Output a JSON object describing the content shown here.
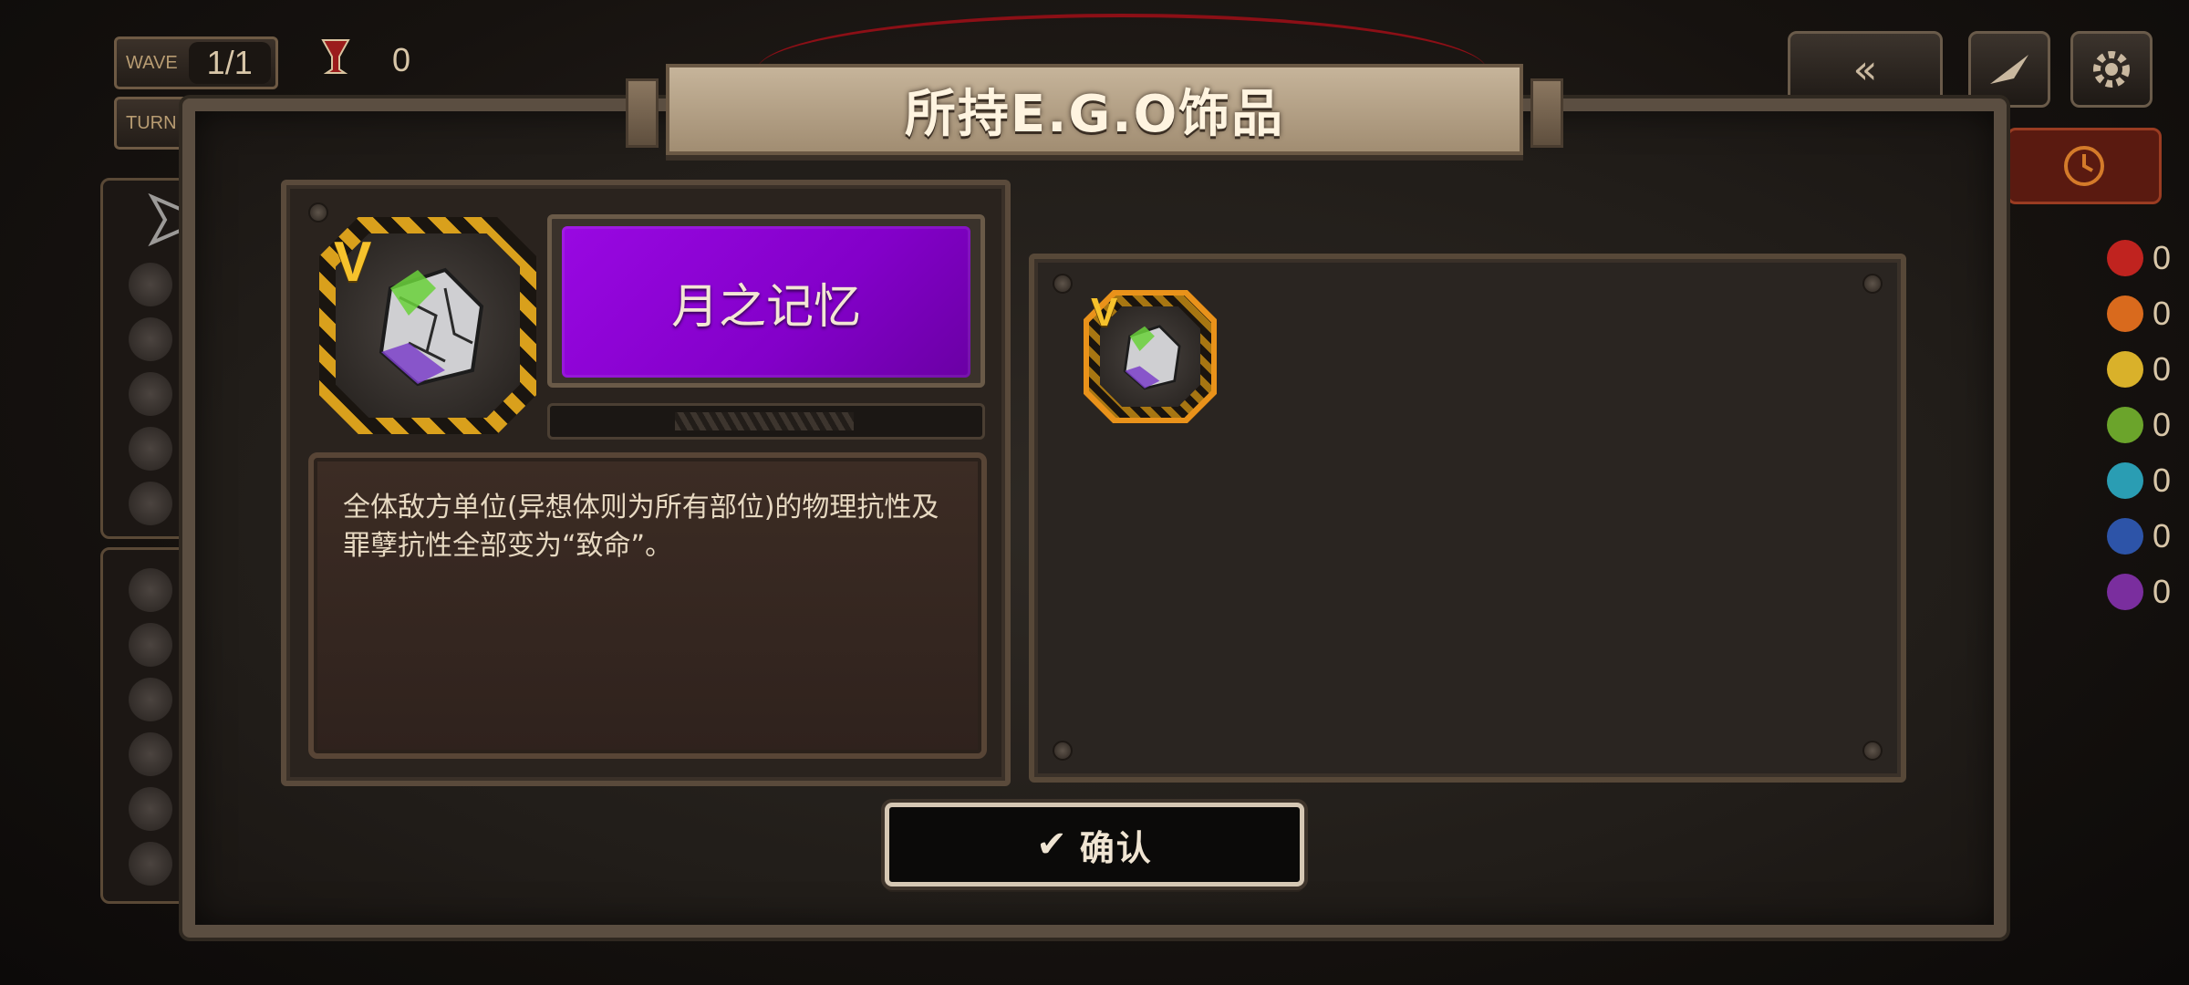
{
  "hud": {
    "wave_label": "WAVE",
    "wave_value": "1/1",
    "turn_label": "TURN",
    "pe_value": "0"
  },
  "resources": [
    {
      "icon": "wrath-icon",
      "color": "#c0231f",
      "value": "0"
    },
    {
      "icon": "lust-icon",
      "color": "#d96a1d",
      "value": "0"
    },
    {
      "icon": "sloth-icon",
      "color": "#d9b12a",
      "value": "0"
    },
    {
      "icon": "gluttony-icon",
      "color": "#6ba42b",
      "value": "0"
    },
    {
      "icon": "gloom-icon",
      "color": "#2a9db3",
      "value": "0"
    },
    {
      "icon": "pride-icon",
      "color": "#2d54a8",
      "value": "0"
    },
    {
      "icon": "envy-icon",
      "color": "#7a2e9e",
      "value": "0"
    }
  ],
  "modal": {
    "title": "所持E.G.O饰品",
    "selected": {
      "rank": "V",
      "name": "月之记忆",
      "name_color": "#9908e2",
      "description": "全体敌方单位(异想体则为所有部位)的物理抗性及罪孽抗性全部变为“致命”。"
    },
    "inventory": [
      {
        "rank": "V",
        "icon": "moon-memory-gift-icon",
        "frame_color": "#e9921a"
      }
    ],
    "confirm_label": "确认"
  }
}
